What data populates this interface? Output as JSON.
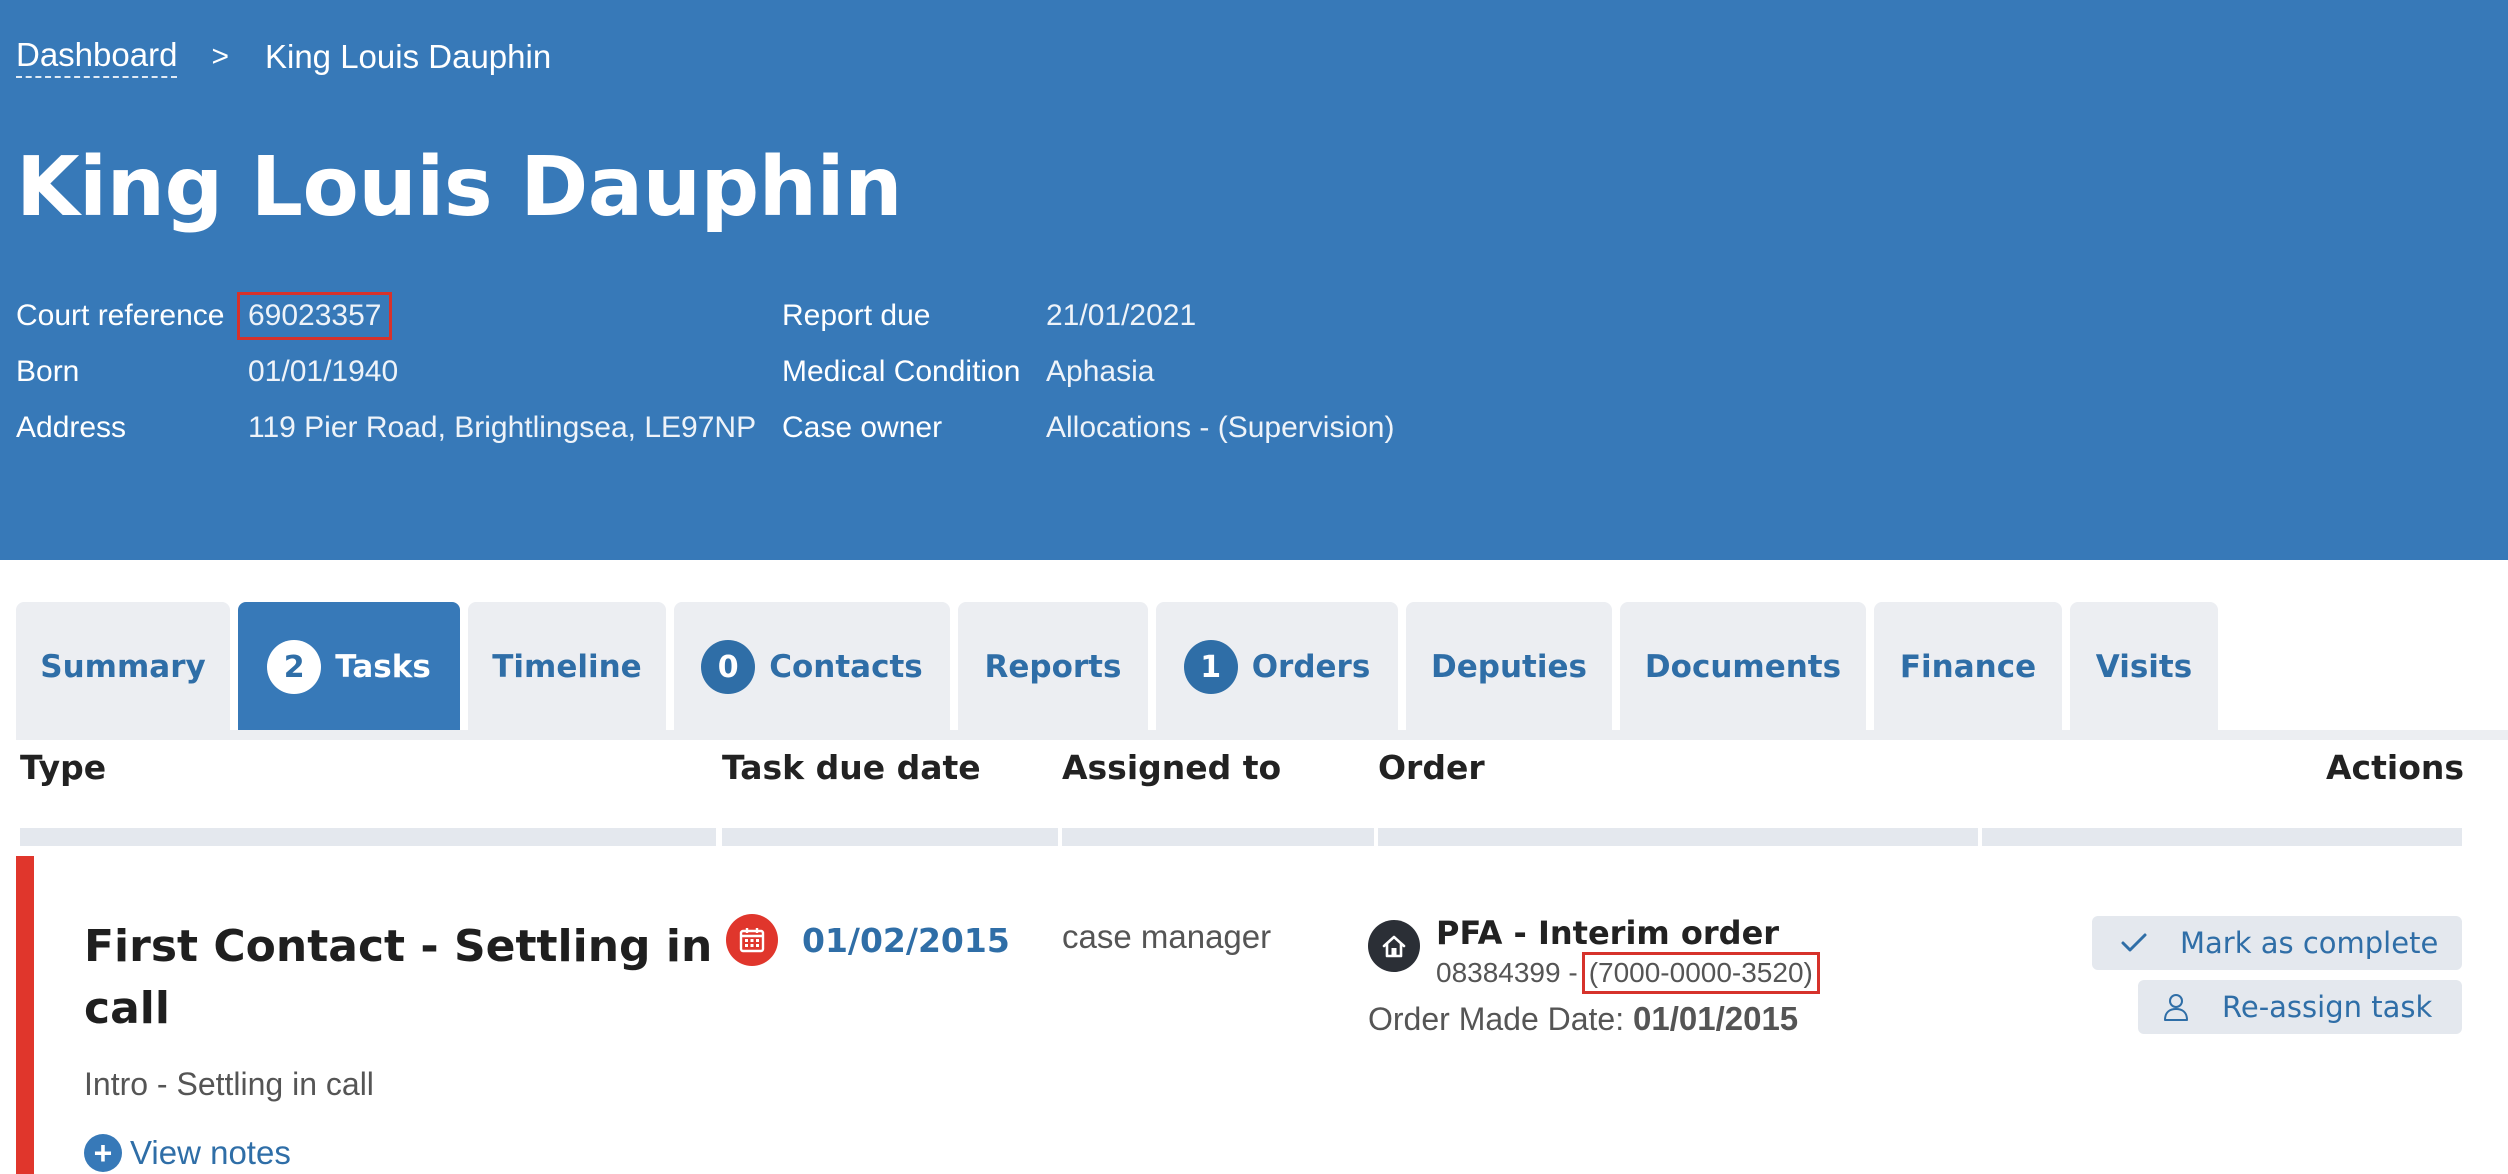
{
  "breadcrumb": {
    "dashboard": "Dashboard",
    "separator": ">",
    "current": "King Louis Dauphin"
  },
  "page_title": "King Louis Dauphin",
  "details_left": [
    {
      "label": "Court reference",
      "value": "69023357"
    },
    {
      "label": "Born",
      "value": "01/01/1940"
    },
    {
      "label": "Address",
      "value": "119 Pier Road, Brightlingsea, LE97NP"
    }
  ],
  "details_right": [
    {
      "label": "Report due",
      "value": "21/01/2021"
    },
    {
      "label": "Medical Condition",
      "value": "Aphasia"
    },
    {
      "label": "Case owner",
      "value": "Allocations - (Supervision)"
    }
  ],
  "tabs": [
    {
      "label": "Summary",
      "count": null
    },
    {
      "label": "Tasks",
      "count": "2",
      "active": true
    },
    {
      "label": "Timeline",
      "count": null
    },
    {
      "label": "Contacts",
      "count": "0"
    },
    {
      "label": "Reports",
      "count": null
    },
    {
      "label": "Orders",
      "count": "1"
    },
    {
      "label": "Deputies",
      "count": null
    },
    {
      "label": "Documents",
      "count": null
    },
    {
      "label": "Finance",
      "count": null
    },
    {
      "label": "Visits",
      "count": null
    }
  ],
  "table": {
    "headers": {
      "type": "Type",
      "due": "Task due date",
      "assigned": "Assigned to",
      "order": "Order",
      "actions": "Actions"
    },
    "row": {
      "title": "First Contact - Settling in call",
      "subtitle": "Intro - Settling in call",
      "view_notes": "View notes",
      "due_date": "01/02/2015",
      "assigned_to": "case manager",
      "order_name": "PFA - Interim order",
      "order_number": "08384399 -",
      "order_ref": "(7000-0000-3520)",
      "order_made_label": "Order Made Date:",
      "order_made_date": "01/01/2015",
      "action_complete": "Mark as complete",
      "action_reassign": "Re-assign task"
    }
  },
  "colors": {
    "header_bg": "#3779b8",
    "accent_blue": "#2f6ea7",
    "alert_red": "#e0362c",
    "highlight_box": "#d6322b"
  },
  "icons": {
    "due": "calendar-icon",
    "order": "house-icon",
    "complete": "check-icon",
    "reassign": "user-icon",
    "notes": "plus-circle-icon"
  }
}
